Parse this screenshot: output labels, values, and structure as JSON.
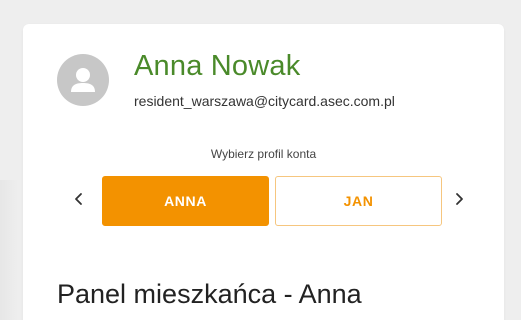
{
  "user": {
    "name": "Anna Nowak",
    "email": "resident_warszawa@citycard.asec.com.pl",
    "avatar_icon": "user-avatar-icon"
  },
  "profile_selector": {
    "prompt": "Wybierz profil konta",
    "profiles": [
      {
        "label": "ANNA",
        "active": true
      },
      {
        "label": "JAN",
        "active": false
      }
    ],
    "prev_icon": "chevron-left-icon",
    "next_icon": "chevron-right-icon"
  },
  "panel": {
    "title": "Panel mieszkańca - Anna"
  },
  "colors": {
    "accent": "#f39200",
    "name_green": "#4a8a2a",
    "avatar_gray": "#c7c7c7"
  }
}
